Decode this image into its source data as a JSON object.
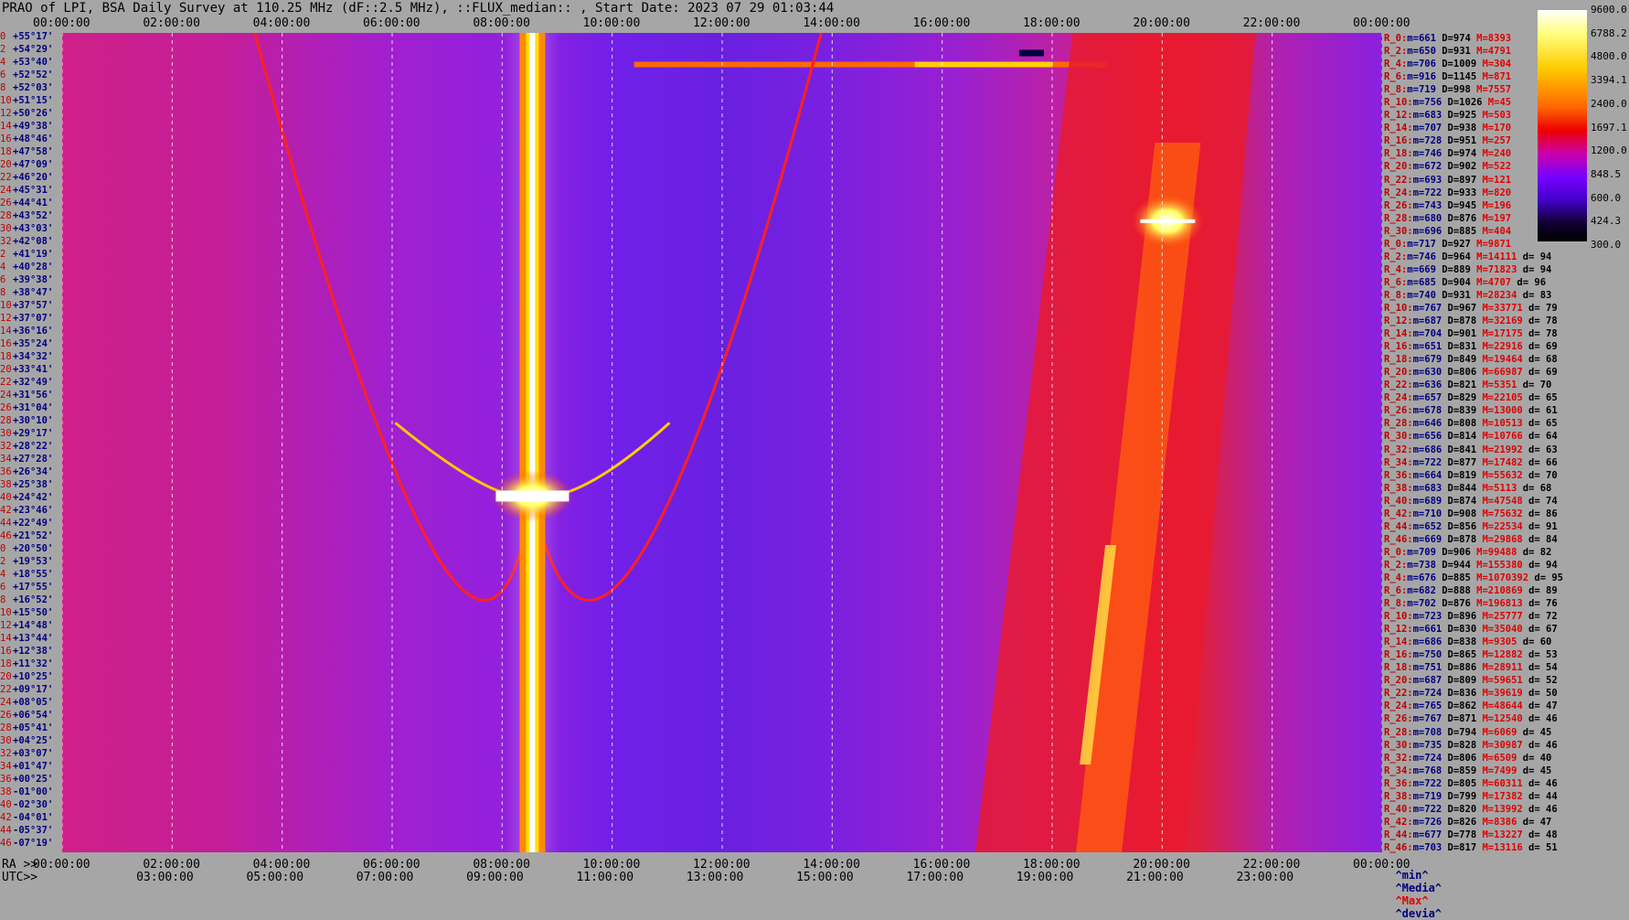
{
  "title": "PRAO of LPI, BSA Daily Survey at 110.25 MHz (dF::2.5 MHz), ::FLUX_median:: , Start Date: 2023 07 29 01:03:44",
  "top_ticks": [
    "00:00:00",
    "02:00:00",
    "04:00:00",
    "06:00:00",
    "08:00:00",
    "10:00:00",
    "12:00:00",
    "14:00:00",
    "16:00:00",
    "18:00:00",
    "20:00:00",
    "22:00:00",
    "00:00:00"
  ],
  "ra_prefix": "RA >>",
  "ra_ticks": [
    "00:00:00",
    "02:00:00",
    "04:00:00",
    "06:00:00",
    "08:00:00",
    "10:00:00",
    "12:00:00",
    "14:00:00",
    "16:00:00",
    "18:00:00",
    "20:00:00",
    "22:00:00",
    "00:00:00"
  ],
  "utc_prefix": "UTC>>",
  "utc_ticks": [
    "03:00:00",
    "05:00:00",
    "07:00:00",
    "09:00:00",
    "11:00:00",
    "13:00:00",
    "15:00:00",
    "17:00:00",
    "19:00:00",
    "21:00:00",
    "23:00:00"
  ],
  "colorbar": {
    "labels": [
      "9600.0",
      "6788.2",
      "4800.0",
      "3394.1",
      "2400.0",
      "1697.1",
      "1200.0",
      "848.5",
      "600.0",
      "424.3",
      "300.0"
    ]
  },
  "legend": {
    "min": "^min^",
    "median": "^Media^",
    "max": "^Max^",
    "dev": "^devia^"
  },
  "declinations": [
    {
      "n": "0",
      "v": "+55°17'"
    },
    {
      "n": "2",
      "v": "+54°29'"
    },
    {
      "n": "4",
      "v": "+53°40'"
    },
    {
      "n": "6",
      "v": "+52°52'"
    },
    {
      "n": "8",
      "v": "+52°03'"
    },
    {
      "n": "10",
      "v": "+51°15'"
    },
    {
      "n": "12",
      "v": "+50°26'"
    },
    {
      "n": "14",
      "v": "+49°38'"
    },
    {
      "n": "16",
      "v": "+48°46'"
    },
    {
      "n": "18",
      "v": "+47°58'"
    },
    {
      "n": "20",
      "v": "+47°09'"
    },
    {
      "n": "22",
      "v": "+46°20'"
    },
    {
      "n": "24",
      "v": "+45°31'"
    },
    {
      "n": "26",
      "v": "+44°41'"
    },
    {
      "n": "28",
      "v": "+43°52'"
    },
    {
      "n": "30",
      "v": "+43°03'"
    },
    {
      "n": "32",
      "v": "+42°08'"
    },
    {
      "n": "2",
      "v": "+41°19'"
    },
    {
      "n": "4",
      "v": "+40°28'"
    },
    {
      "n": "6",
      "v": "+39°38'"
    },
    {
      "n": "8",
      "v": "+38°47'"
    },
    {
      "n": "10",
      "v": "+37°57'"
    },
    {
      "n": "12",
      "v": "+37°07'"
    },
    {
      "n": "14",
      "v": "+36°16'"
    },
    {
      "n": "16",
      "v": "+35°24'"
    },
    {
      "n": "18",
      "v": "+34°32'"
    },
    {
      "n": "20",
      "v": "+33°41'"
    },
    {
      "n": "22",
      "v": "+32°49'"
    },
    {
      "n": "24",
      "v": "+31°56'"
    },
    {
      "n": "26",
      "v": "+31°04'"
    },
    {
      "n": "28",
      "v": "+30°10'"
    },
    {
      "n": "30",
      "v": "+29°17'"
    },
    {
      "n": "32",
      "v": "+28°22'"
    },
    {
      "n": "34",
      "v": "+27°28'"
    },
    {
      "n": "36",
      "v": "+26°34'"
    },
    {
      "n": "38",
      "v": "+25°38'"
    },
    {
      "n": "40",
      "v": "+24°42'"
    },
    {
      "n": "42",
      "v": "+23°46'"
    },
    {
      "n": "44",
      "v": "+22°49'"
    },
    {
      "n": "46",
      "v": "+21°52'"
    },
    {
      "n": "0",
      "v": "+20°50'"
    },
    {
      "n": "2",
      "v": "+19°53'"
    },
    {
      "n": "4",
      "v": "+18°55'"
    },
    {
      "n": "6",
      "v": "+17°55'"
    },
    {
      "n": "8",
      "v": "+16°52'"
    },
    {
      "n": "10",
      "v": "+15°50'"
    },
    {
      "n": "12",
      "v": "+14°48'"
    },
    {
      "n": "14",
      "v": "+13°44'"
    },
    {
      "n": "16",
      "v": "+12°38'"
    },
    {
      "n": "18",
      "v": "+11°32'"
    },
    {
      "n": "20",
      "v": "+10°25'"
    },
    {
      "n": "22",
      "v": "+09°17'"
    },
    {
      "n": "24",
      "v": "+08°05'"
    },
    {
      "n": "26",
      "v": "+06°54'"
    },
    {
      "n": "28",
      "v": "+05°41'"
    },
    {
      "n": "30",
      "v": "+04°25'"
    },
    {
      "n": "32",
      "v": "+03°07'"
    },
    {
      "n": "34",
      "v": "+01°47'"
    },
    {
      "n": "36",
      "v": "+00°25'"
    },
    {
      "n": "38",
      "v": "-01°00'"
    },
    {
      "n": "40",
      "v": "-02°30'"
    },
    {
      "n": "42",
      "v": "-04°01'"
    },
    {
      "n": "44",
      "v": "-05°37'"
    },
    {
      "n": "46",
      "v": "-07°19'"
    }
  ],
  "stats": [
    {
      "r": "R_0:",
      "m": "m=661",
      "d": "D=974",
      "x": "M=8393",
      "dv": ""
    },
    {
      "r": "R_2:",
      "m": "m=650",
      "d": "D=931",
      "x": "M=4791",
      "dv": ""
    },
    {
      "r": "R_4:",
      "m": "m=706",
      "d": "D=1009",
      "x": "M=304",
      "dv": ""
    },
    {
      "r": "R_6:",
      "m": "m=916",
      "d": "D=1145",
      "x": "M=871",
      "dv": ""
    },
    {
      "r": "R_8:",
      "m": "m=719",
      "d": "D=998",
      "x": "M=7557",
      "dv": ""
    },
    {
      "r": "R_10:",
      "m": "m=756",
      "d": "D=1026",
      "x": "M=45",
      "dv": ""
    },
    {
      "r": "R_12:",
      "m": "m=683",
      "d": "D=925",
      "x": "M=503",
      "dv": ""
    },
    {
      "r": "R_14:",
      "m": "m=707",
      "d": "D=938",
      "x": "M=170",
      "dv": ""
    },
    {
      "r": "R_16:",
      "m": "m=728",
      "d": "D=951",
      "x": "M=257",
      "dv": ""
    },
    {
      "r": "R_18:",
      "m": "m=746",
      "d": "D=974",
      "x": "M=240",
      "dv": ""
    },
    {
      "r": "R_20:",
      "m": "m=672",
      "d": "D=902",
      "x": "M=522",
      "dv": ""
    },
    {
      "r": "R_22:",
      "m": "m=693",
      "d": "D=897",
      "x": "M=121",
      "dv": ""
    },
    {
      "r": "R_24:",
      "m": "m=722",
      "d": "D=933",
      "x": "M=820",
      "dv": ""
    },
    {
      "r": "R_26:",
      "m": "m=743",
      "d": "D=945",
      "x": "M=196",
      "dv": ""
    },
    {
      "r": "R_28:",
      "m": "m=680",
      "d": "D=876",
      "x": "M=197",
      "dv": ""
    },
    {
      "r": "R_30:",
      "m": "m=696",
      "d": "D=885",
      "x": "M=404",
      "dv": ""
    },
    {
      "r": "R_0:",
      "m": "m=717",
      "d": "D=927",
      "x": "M=9871",
      "dv": ""
    },
    {
      "r": "R_2:",
      "m": "m=746",
      "d": "D=964",
      "x": "M=14111",
      "dv": "d= 94"
    },
    {
      "r": "R_4:",
      "m": "m=669",
      "d": "D=889",
      "x": "M=71823",
      "dv": "d= 94"
    },
    {
      "r": "R_6:",
      "m": "m=685",
      "d": "D=904",
      "x": "M=4707",
      "dv": "d= 96"
    },
    {
      "r": "R_8:",
      "m": "m=740",
      "d": "D=931",
      "x": "M=28234",
      "dv": "d= 83"
    },
    {
      "r": "R_10:",
      "m": "m=767",
      "d": "D=967",
      "x": "M=33771",
      "dv": "d= 79"
    },
    {
      "r": "R_12:",
      "m": "m=687",
      "d": "D=878",
      "x": "M=32169",
      "dv": "d= 78"
    },
    {
      "r": "R_14:",
      "m": "m=704",
      "d": "D=901",
      "x": "M=17175",
      "dv": "d= 78"
    },
    {
      "r": "R_16:",
      "m": "m=651",
      "d": "D=831",
      "x": "M=22916",
      "dv": "d= 69"
    },
    {
      "r": "R_18:",
      "m": "m=679",
      "d": "D=849",
      "x": "M=19464",
      "dv": "d= 68"
    },
    {
      "r": "R_20:",
      "m": "m=630",
      "d": "D=806",
      "x": "M=66987",
      "dv": "d= 69"
    },
    {
      "r": "R_22:",
      "m": "m=636",
      "d": "D=821",
      "x": "M=5351",
      "dv": "d= 70"
    },
    {
      "r": "R_24:",
      "m": "m=657",
      "d": "D=829",
      "x": "M=22105",
      "dv": "d= 65"
    },
    {
      "r": "R_26:",
      "m": "m=678",
      "d": "D=839",
      "x": "M=13000",
      "dv": "d= 61"
    },
    {
      "r": "R_28:",
      "m": "m=646",
      "d": "D=808",
      "x": "M=10513",
      "dv": "d= 65"
    },
    {
      "r": "R_30:",
      "m": "m=656",
      "d": "D=814",
      "x": "M=10766",
      "dv": "d= 64"
    },
    {
      "r": "R_32:",
      "m": "m=686",
      "d": "D=841",
      "x": "M=21992",
      "dv": "d= 63"
    },
    {
      "r": "R_34:",
      "m": "m=722",
      "d": "D=877",
      "x": "M=17482",
      "dv": "d= 66"
    },
    {
      "r": "R_36:",
      "m": "m=664",
      "d": "D=819",
      "x": "M=55632",
      "dv": "d= 70"
    },
    {
      "r": "R_38:",
      "m": "m=683",
      "d": "D=844",
      "x": "M=5113",
      "dv": "d= 68"
    },
    {
      "r": "R_40:",
      "m": "m=689",
      "d": "D=874",
      "x": "M=47548",
      "dv": "d= 74"
    },
    {
      "r": "R_42:",
      "m": "m=710",
      "d": "D=908",
      "x": "M=75632",
      "dv": "d= 86"
    },
    {
      "r": "R_44:",
      "m": "m=652",
      "d": "D=856",
      "x": "M=22534",
      "dv": "d= 91"
    },
    {
      "r": "R_46:",
      "m": "m=669",
      "d": "D=878",
      "x": "M=29868",
      "dv": "d= 84"
    },
    {
      "r": "R_0:",
      "m": "m=709",
      "d": "D=906",
      "x": "M=99488",
      "dv": "d= 82"
    },
    {
      "r": "R_2:",
      "m": "m=738",
      "d": "D=944",
      "x": "M=155380",
      "dv": "d= 94"
    },
    {
      "r": "R_4:",
      "m": "m=676",
      "d": "D=885",
      "x": "M=1070392",
      "dv": "d= 95"
    },
    {
      "r": "R_6:",
      "m": "m=682",
      "d": "D=888",
      "x": "M=210869",
      "dv": "d= 89"
    },
    {
      "r": "R_8:",
      "m": "m=702",
      "d": "D=876",
      "x": "M=196813",
      "dv": "d= 76"
    },
    {
      "r": "R_10:",
      "m": "m=723",
      "d": "D=896",
      "x": "M=25777",
      "dv": "d= 72"
    },
    {
      "r": "R_12:",
      "m": "m=661",
      "d": "D=830",
      "x": "M=35040",
      "dv": "d= 67"
    },
    {
      "r": "R_14:",
      "m": "m=686",
      "d": "D=838",
      "x": "M=9305",
      "dv": "d= 60"
    },
    {
      "r": "R_16:",
      "m": "m=750",
      "d": "D=865",
      "x": "M=12882",
      "dv": "d= 53"
    },
    {
      "r": "R_18:",
      "m": "m=751",
      "d": "D=886",
      "x": "M=28911",
      "dv": "d= 54"
    },
    {
      "r": "R_20:",
      "m": "m=687",
      "d": "D=809",
      "x": "M=59651",
      "dv": "d= 52"
    },
    {
      "r": "R_22:",
      "m": "m=724",
      "d": "D=836",
      "x": "M=39619",
      "dv": "d= 50"
    },
    {
      "r": "R_24:",
      "m": "m=765",
      "d": "D=862",
      "x": "M=48644",
      "dv": "d= 47"
    },
    {
      "r": "R_26:",
      "m": "m=767",
      "d": "D=871",
      "x": "M=12540",
      "dv": "d= 46"
    },
    {
      "r": "R_28:",
      "m": "m=708",
      "d": "D=794",
      "x": "M=6069",
      "dv": "d= 45"
    },
    {
      "r": "R_30:",
      "m": "m=735",
      "d": "D=828",
      "x": "M=30987",
      "dv": "d= 46"
    },
    {
      "r": "R_32:",
      "m": "m=724",
      "d": "D=806",
      "x": "M=6509",
      "dv": "d= 40"
    },
    {
      "r": "R_34:",
      "m": "m=768",
      "d": "D=859",
      "x": "M=7499",
      "dv": "d= 45"
    },
    {
      "r": "R_36:",
      "m": "m=722",
      "d": "D=805",
      "x": "M=60311",
      "dv": "d= 46"
    },
    {
      "r": "R_38:",
      "m": "m=719",
      "d": "D=799",
      "x": "M=17382",
      "dv": "d= 44"
    },
    {
      "r": "R_40:",
      "m": "m=722",
      "d": "D=820",
      "x": "M=13992",
      "dv": "d= 46"
    },
    {
      "r": "R_42:",
      "m": "m=726",
      "d": "D=826",
      "x": "M=8386",
      "dv": "d= 47"
    },
    {
      "r": "R_44:",
      "m": "m=677",
      "d": "D=778",
      "x": "M=13227",
      "dv": "d= 48"
    },
    {
      "r": "R_46:",
      "m": "m=703",
      "d": "D=817",
      "x": "M=13116",
      "dv": "d= 51"
    }
  ],
  "chart_data": {
    "type": "heatmap",
    "title": "PRAO of LPI, BSA Daily Survey at 110.25 MHz (dF::2.5 MHz), ::FLUX_median:: , Start Date: 2023 07 29 01:03:44",
    "xlabel": "RA / UTC",
    "x_range_hours": [
      0,
      24
    ],
    "y_range_deg": [
      55.28,
      -7.32
    ],
    "colormap": "black-purple-red-yellow-white",
    "color_scale": "log",
    "color_range": [
      300,
      9600
    ],
    "features": [
      {
        "name": "bright vertical source",
        "ra_hours": 8.55,
        "dec_range": [
          55.28,
          -7.32
        ]
      },
      {
        "name": "parabolic track",
        "vertex_ra_hours": 8.55,
        "vertex_dec": 19.9,
        "ends_ra_hours": [
          3.5,
          13.8
        ]
      },
      {
        "name": "galactic plane band",
        "ra_hours_top": 20.2,
        "ra_hours_bottom": 18.6
      },
      {
        "name": "bright spot",
        "ra_hours": 20.1,
        "dec": 40.9
      },
      {
        "name": "horizontal streak",
        "dec": 52.87,
        "ra_range_hours": [
          10.4,
          19.0
        ]
      }
    ],
    "grid": true
  }
}
